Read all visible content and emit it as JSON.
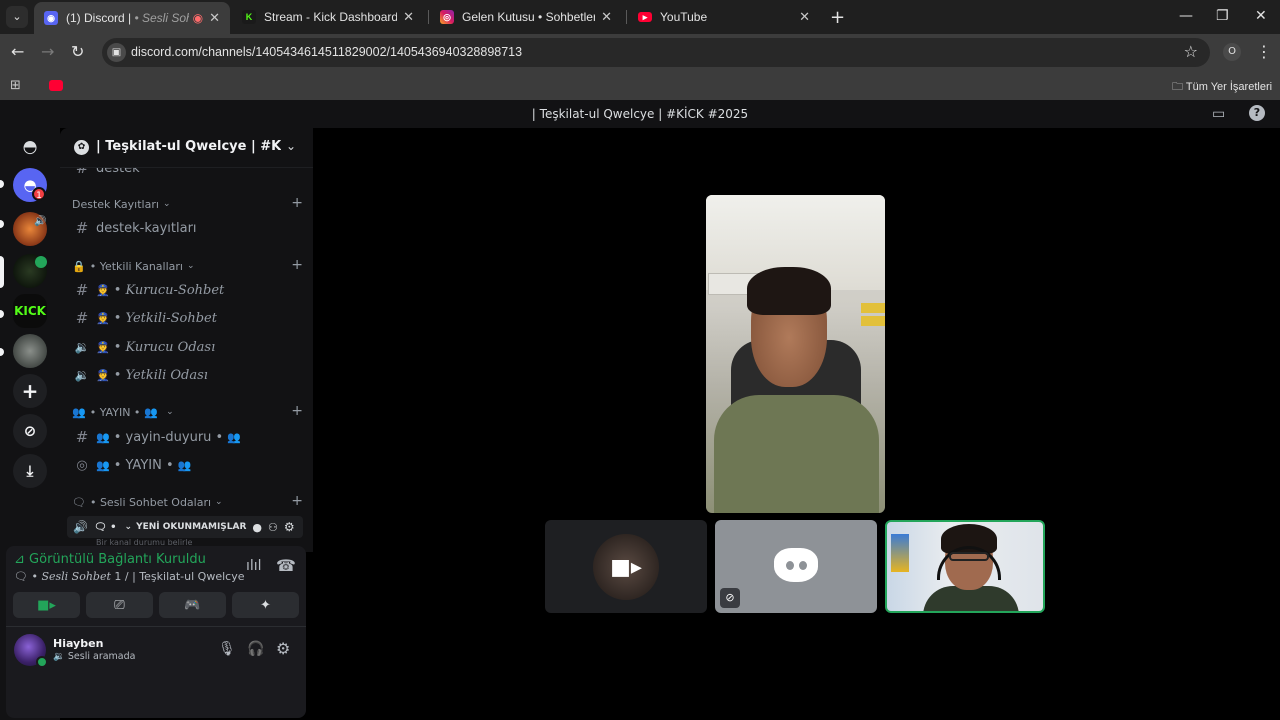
{
  "browser": {
    "tabs": [
      {
        "title": "(1) Discord | ",
        "title_extra": "• Sesli Sohb",
        "active": true
      },
      {
        "title": "Stream - Kick Dashboard",
        "active": false
      },
      {
        "title": "Gelen Kutusu • Sohbetler",
        "active": false
      },
      {
        "title": "YouTube",
        "active": false
      }
    ],
    "url": "discord.com/channels/1405434614511829002/1405436940328898713",
    "profile_initial": "O",
    "bookmarks_all": "Tüm Yer İşaretleri"
  },
  "discord": {
    "title": "| Teşkilat-ul Qwelcye | #KİCK #2025",
    "server_name": "| Teşkilat-ul Qwelcye | #KİCK ...",
    "guild_badge": "1",
    "guild_kick_label": "KICK",
    "channels": {
      "partial_top": "destek",
      "cat1": "Destek Kayıtları",
      "ch_destek_kayitlari": "destek-kayıtları",
      "cat2": "• Yetkili Kanalları",
      "ch_kurucu_sohbet": "• Kurucu-Sohbet",
      "ch_yetkili_sohbet": "• Yetkili-Sohbet",
      "ch_kurucu_odasi": "• Kurucu Odası",
      "ch_yetkili_odasi": "• Yetkili Odası",
      "cat3": "• YAYIN •",
      "ch_yayin_duyuru": "• yayin-duyuru •",
      "ch_yayin": "• YAYIN •",
      "cat4": "• Sesli Sohbet Odaları",
      "partial_bottom": "Bir kanal durumu belirle"
    },
    "unread_label": "YENİ OKUNMAMIŞLAR",
    "voice": {
      "status": "Görüntülü Bağlantı Kuruldu",
      "channel_italic": "Sesli Sohbet",
      "channel_rest": " 1 / | Teşkilat-ul Qwelcye ..."
    },
    "user": {
      "name": "Hiayben",
      "status": "Sesli aramada"
    }
  }
}
